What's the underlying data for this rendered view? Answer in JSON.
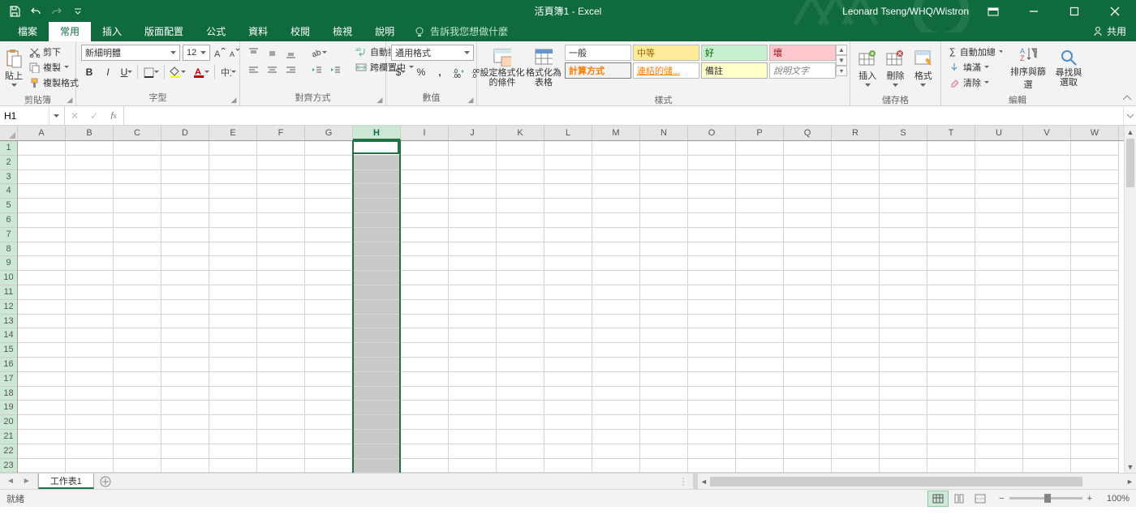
{
  "titlebar": {
    "title": "活頁簿1 - Excel",
    "user": "Leonard Tseng/WHQ/Wistron"
  },
  "tabs": {
    "file": "檔案",
    "home": "常用",
    "insert": "插入",
    "layout": "版面配置",
    "formulas": "公式",
    "data": "資料",
    "review": "校閱",
    "view": "檢視",
    "help": "說明",
    "tellme": "告訴我您想做什麼",
    "share": "共用"
  },
  "ribbon": {
    "clipboard": {
      "label": "剪貼簿",
      "paste": "貼上",
      "cut": "剪下",
      "copy": "複製",
      "painter": "複製格式"
    },
    "font": {
      "label": "字型",
      "name": "新細明體",
      "size": "12"
    },
    "align": {
      "label": "對齊方式",
      "wrap": "自動換列",
      "merge": "跨欄置中"
    },
    "number": {
      "label": "數值",
      "format": "通用格式"
    },
    "styles": {
      "label": "樣式",
      "condfmt": "設定格式化\n的條件",
      "table": "格式化為\n表格",
      "gallery": [
        "一般",
        "中等",
        "好",
        "壞",
        "計算方式",
        "連結的儲...",
        "備註",
        "說明文字"
      ]
    },
    "cells": {
      "label": "儲存格",
      "insert": "插入",
      "delete": "刪除",
      "format": "格式"
    },
    "editing": {
      "label": "編輯",
      "autosum": "自動加總",
      "fill": "填滿",
      "clear": "清除",
      "sort": "排序與篩選",
      "find": "尋找與\n選取"
    }
  },
  "formulabar": {
    "namebox": "H1",
    "formula": ""
  },
  "grid": {
    "columns": [
      "A",
      "B",
      "C",
      "D",
      "E",
      "F",
      "G",
      "H",
      "I",
      "J",
      "K",
      "L",
      "M",
      "N",
      "O",
      "P",
      "Q",
      "R",
      "S",
      "T",
      "U",
      "V",
      "W"
    ],
    "rows": [
      1,
      2,
      3,
      4,
      5,
      6,
      7,
      8,
      9,
      10,
      11,
      12,
      13,
      14,
      15,
      16,
      17,
      18,
      19,
      20,
      21,
      22,
      23
    ],
    "selected_col_index": 7
  },
  "sheettabs": {
    "sheet1": "工作表1"
  },
  "status": {
    "ready": "就緒",
    "zoom": "100%"
  }
}
